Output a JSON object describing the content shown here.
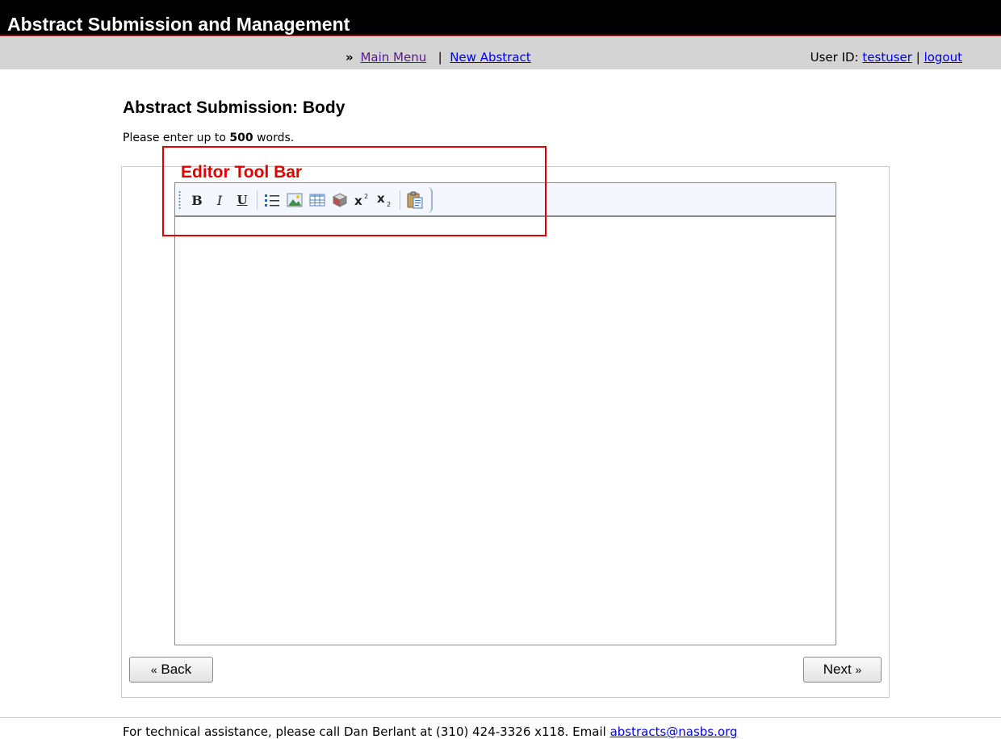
{
  "header": {
    "app_title": "Abstract Submission and Management"
  },
  "nav": {
    "separator_glyph": "»",
    "main_menu": "Main Menu",
    "divider": "|",
    "new_abstract": "New Abstract",
    "user_id_label": "User ID:",
    "user_id": "testuser",
    "logout": "logout"
  },
  "page": {
    "heading": "Abstract Submission: Body",
    "instructions_prefix": "Please enter up to ",
    "word_limit": "500",
    "instructions_suffix": " words."
  },
  "annotation": {
    "label": "Editor Tool Bar",
    "color": "#e00000"
  },
  "editor": {
    "toolbar": [
      {
        "name": "bold",
        "label": "B",
        "icon": "bold-icon"
      },
      {
        "name": "italic",
        "label": "I",
        "icon": "italic-icon"
      },
      {
        "name": "underline",
        "label": "U",
        "icon": "underline-icon"
      },
      {
        "name": "bullet-list",
        "icon": "bullet-list-icon"
      },
      {
        "name": "image",
        "icon": "image-icon"
      },
      {
        "name": "table",
        "icon": "table-icon"
      },
      {
        "name": "special-char",
        "icon": "cube-icon"
      },
      {
        "name": "superscript",
        "label": "x²",
        "icon": "superscript-icon"
      },
      {
        "name": "subscript",
        "label": "x₂",
        "icon": "subscript-icon"
      },
      {
        "name": "paste",
        "icon": "paste-icon"
      }
    ],
    "content": ""
  },
  "buttons": {
    "back_chevron": "«",
    "back": "Back",
    "next": "Next",
    "next_chevron": "»"
  },
  "footer": {
    "text": "For technical assistance, please call Dan Berlant at (310) 424-3326 x118. Email ",
    "email": "abstracts@nasbs.org"
  },
  "colors": {
    "header_bg": "#000000",
    "nav_bg": "#d4d4d4",
    "link": "#0000ee",
    "visited_link": "#551a8b",
    "toolbar_bg": "#f4f7fd"
  }
}
